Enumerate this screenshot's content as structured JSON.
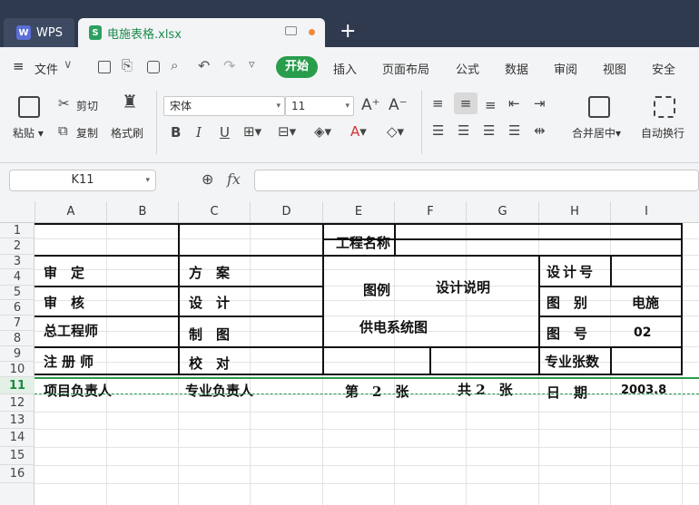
{
  "app": {
    "brand": "WPS",
    "file_tab": "电施表格.xlsx",
    "new_tab": "+"
  },
  "menu": {
    "file": "文件",
    "items": [
      "开始",
      "插入",
      "页面布局",
      "公式",
      "数据",
      "审阅",
      "视图",
      "安全"
    ]
  },
  "ribbon": {
    "paste": "粘贴",
    "cut": "剪切",
    "copy": "复制",
    "format_painter": "格式刷",
    "font_name": "宋体",
    "font_size": "11",
    "merge_center": "合并居中",
    "wrap_text": "自动换行"
  },
  "formula_bar": {
    "name_box": "K11",
    "fx": "fx"
  },
  "columns": [
    "A",
    "B",
    "C",
    "D",
    "E",
    "F",
    "G",
    "H",
    "I"
  ],
  "rows": [
    "1",
    "2",
    "3",
    "4",
    "5",
    "6",
    "7",
    "8",
    "9",
    "10",
    "11",
    "12",
    "13",
    "14",
    "15",
    "16"
  ],
  "selected_row": "11",
  "sheet": {
    "project_name": "工程名称",
    "left_labels": [
      "审　定",
      "审　核",
      "总工程师",
      "注册师",
      "项目负责人"
    ],
    "mid_labels": [
      "方　案",
      "设　计",
      "制　图",
      "校　对",
      "专业负责人"
    ],
    "legend": "图例",
    "design_notes": "设计说明",
    "system_diagram": "供电系统图",
    "sheet_no": "第　2　张",
    "sheet_total": "共 2　张",
    "design_no": "设计号",
    "drawing_type": "图　别",
    "drawing_type_value": "电施",
    "drawing_no": "图　号",
    "drawing_no_value": "02",
    "sheet_count": "专业张数",
    "date_label": "日　期",
    "date_value": "2003.8"
  }
}
